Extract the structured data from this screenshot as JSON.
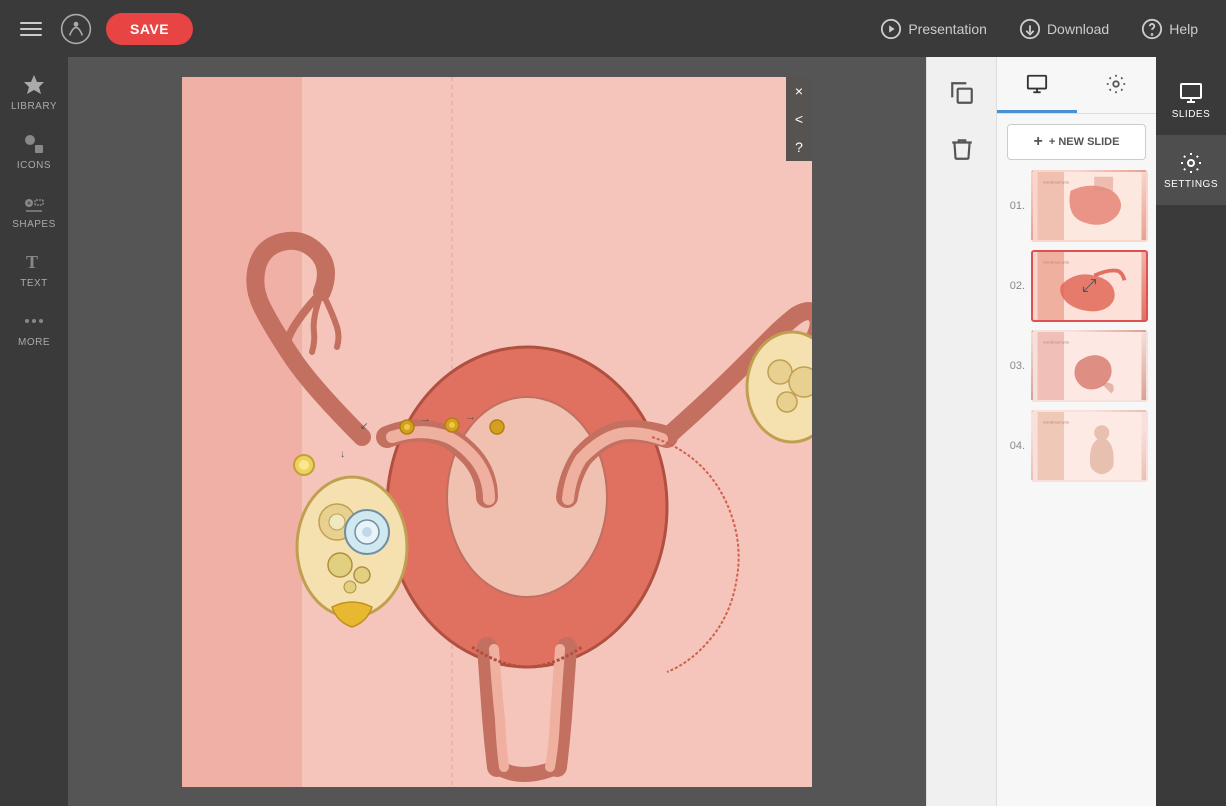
{
  "topbar": {
    "save_label": "SAVE",
    "presentation_label": "Presentation",
    "download_label": "Download",
    "help_label": "Help"
  },
  "left_sidebar": {
    "items": [
      {
        "id": "library",
        "label": "LIBRARY",
        "icon": "star-icon"
      },
      {
        "id": "icons",
        "label": "ICONS",
        "icon": "icons-icon"
      },
      {
        "id": "shapes",
        "label": "SHAPES",
        "icon": "shapes-icon"
      },
      {
        "id": "text",
        "label": "TEXT",
        "icon": "text-icon"
      },
      {
        "id": "more",
        "label": "MORE",
        "icon": "more-icon"
      }
    ]
  },
  "slides_panel": {
    "new_slide_label": "+ NEW SLIDE",
    "slides_tab_label": "SLIDES",
    "settings_tab_label": "SETTINGS",
    "slides": [
      {
        "number": "01.",
        "active": false
      },
      {
        "number": "02.",
        "active": true
      },
      {
        "number": "03.",
        "active": false
      },
      {
        "number": "04.",
        "active": false
      }
    ]
  },
  "canvas_controls": {
    "close_label": "×",
    "collapse_label": "<",
    "help_label": "?"
  },
  "right_panel": {
    "duplicate_label": "Duplicate",
    "delete_label": "Delete"
  }
}
